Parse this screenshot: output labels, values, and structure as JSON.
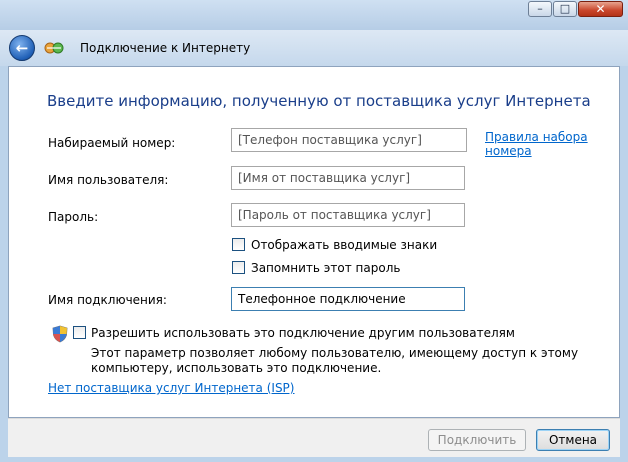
{
  "window": {
    "minimize_glyph": "–",
    "maximize_glyph": "□",
    "close_glyph": "✕"
  },
  "nav": {
    "back_icon": "back-arrow-icon",
    "title": "Подключение к Интернету"
  },
  "main": {
    "heading": "Введите информацию, полученную от поставщика услуг Интернета",
    "fields": {
      "phone": {
        "label": "Набираемый номер:",
        "placeholder": "[Телефон поставщика услуг]"
      },
      "username": {
        "label": "Имя пользователя:",
        "placeholder": "[Имя от поставщика услуг]"
      },
      "password": {
        "label": "Пароль:",
        "placeholder": "[Пароль от поставщика услуг]"
      },
      "connection_name": {
        "label": "Имя подключения:",
        "value": "Телефонное подключение"
      }
    },
    "dialing_rules_link": [
      "Правила набора",
      "номера"
    ],
    "show_chars": "Отображать вводимые знаки",
    "remember_password": "Запомнить этот пароль",
    "allow_others": "Разрешить использовать это подключение другим пользователям",
    "allow_note": [
      "Этот параметр позволяет любому пользователю, имеющему доступ к этому",
      "компьютеру, использовать это подключение."
    ],
    "no_isp_link": "Нет поставщика услуг Интернета (ISP)"
  },
  "footer": {
    "connect": "Подключить",
    "cancel": "Отмена"
  }
}
